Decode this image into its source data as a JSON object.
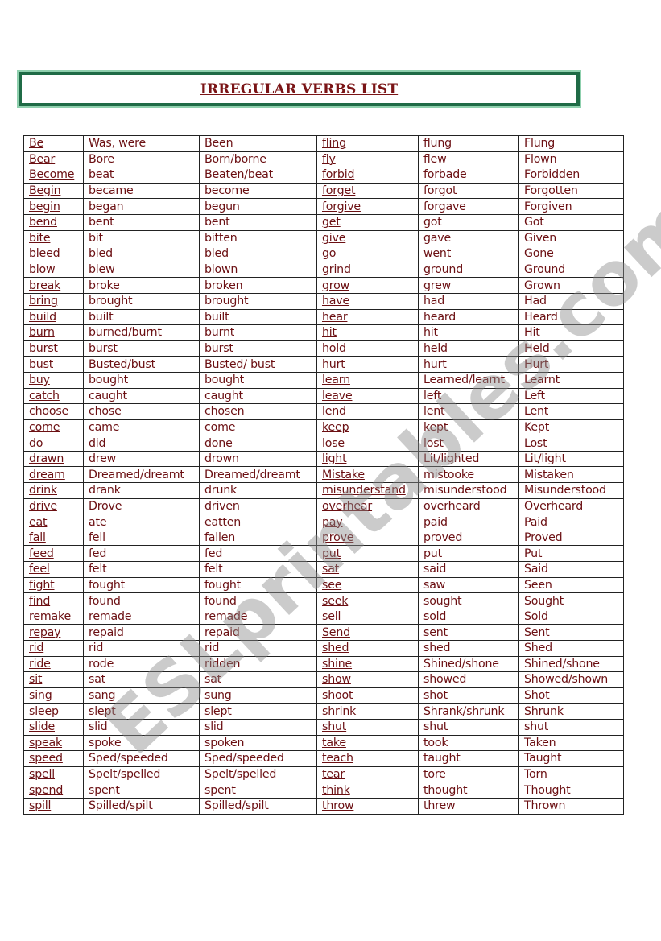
{
  "title": "IRREGULAR VERBS LIST",
  "watermark": "ESLprintables.com",
  "colors": {
    "text": "#6b0f12",
    "title": "#7a1416",
    "frame": "#1f6b46"
  },
  "rows": [
    {
      "l": [
        "Be",
        "Was, were",
        "Been"
      ],
      "r": [
        "fling",
        "flung",
        "Flung"
      ]
    },
    {
      "l": [
        "Bear",
        "Bore",
        "Born/borne"
      ],
      "r": [
        "fly",
        "flew",
        "Flown"
      ]
    },
    {
      "l": [
        "Become",
        "beat",
        "Beaten/beat"
      ],
      "r": [
        "forbid",
        "forbade",
        "Forbidden"
      ]
    },
    {
      "l": [
        "Begin",
        "became",
        "become"
      ],
      "r": [
        "forget",
        "forgot",
        "Forgotten"
      ]
    },
    {
      "l": [
        "begin",
        "began",
        "begun"
      ],
      "r": [
        "forgive",
        "forgave",
        "Forgiven"
      ]
    },
    {
      "l": [
        "bend",
        "bent",
        "bent"
      ],
      "r": [
        "get",
        "got",
        "Got"
      ]
    },
    {
      "l": [
        "bite",
        "bit",
        "bitten"
      ],
      "r": [
        "give",
        "gave",
        "Given"
      ]
    },
    {
      "l": [
        "bleed",
        "bled",
        "bled"
      ],
      "r": [
        "go",
        "went",
        "Gone"
      ]
    },
    {
      "l": [
        "blow",
        "blew",
        "blown"
      ],
      "r": [
        "grind",
        "ground",
        "Ground"
      ]
    },
    {
      "l": [
        "break",
        "broke",
        "broken"
      ],
      "r": [
        "grow",
        "grew",
        "Grown"
      ]
    },
    {
      "l": [
        "bring",
        "brought",
        "brought"
      ],
      "r": [
        "have",
        "had",
        "Had"
      ]
    },
    {
      "l": [
        "build",
        "built",
        "built"
      ],
      "r": [
        "hear",
        "heard",
        "Heard"
      ]
    },
    {
      "l": [
        "burn",
        "burned/burnt",
        "burnt"
      ],
      "r": [
        "hit",
        "hit",
        "Hit"
      ]
    },
    {
      "l": [
        "burst",
        "burst",
        "burst"
      ],
      "r": [
        "hold",
        "held",
        "Held"
      ]
    },
    {
      "l": [
        "bust",
        "Busted/bust",
        "Busted/ bust"
      ],
      "r": [
        "hurt",
        "hurt",
        "Hurt"
      ]
    },
    {
      "l": [
        "buy",
        "bought",
        "bought"
      ],
      "r": [
        "learn",
        "Learned/learnt",
        "Learnt"
      ]
    },
    {
      "l": [
        "catch",
        "caught",
        "caught"
      ],
      "r": [
        "leave",
        "left",
        "Left"
      ]
    },
    {
      "l": [
        "choose",
        "chose",
        "chosen"
      ],
      "r": [
        "lend",
        "lent",
        "Lent"
      ]
    },
    {
      "l": [
        "come",
        "came",
        "come"
      ],
      "r": [
        "keep",
        "kept",
        "Kept"
      ]
    },
    {
      "l": [
        "do",
        "did",
        "done"
      ],
      "r": [
        "lose",
        "lost",
        "Lost"
      ]
    },
    {
      "l": [
        "drawn",
        "drew",
        "drown"
      ],
      "r": [
        "light",
        "Lit/lighted",
        "Lit/light"
      ]
    },
    {
      "l": [
        "dream",
        "Dreamed/dreamt",
        "Dreamed/dreamt"
      ],
      "r": [
        "Mistake",
        "mistooke",
        "Mistaken"
      ]
    },
    {
      "l": [
        "drink",
        "drank",
        "drunk"
      ],
      "r": [
        "misunderstand",
        "misunderstood",
        "Misunderstood"
      ]
    },
    {
      "l": [
        "drive",
        "Drove",
        "driven"
      ],
      "r": [
        "overhear",
        "overheard",
        "Overheard"
      ]
    },
    {
      "l": [
        "eat",
        "ate",
        "eatten"
      ],
      "r": [
        "pay",
        "paid",
        "Paid"
      ]
    },
    {
      "l": [
        "fall",
        "fell",
        "fallen"
      ],
      "r": [
        "prove",
        "proved",
        "Proved"
      ]
    },
    {
      "l": [
        "feed",
        "fed",
        "fed"
      ],
      "r": [
        "put",
        "put",
        "Put"
      ]
    },
    {
      "l": [
        "feel",
        "felt",
        "felt"
      ],
      "r": [
        "sat",
        "said",
        "Said"
      ]
    },
    {
      "l": [
        "fight",
        "fought",
        "fought"
      ],
      "r": [
        "see",
        "saw",
        "Seen"
      ]
    },
    {
      "l": [
        "find",
        "found",
        "found"
      ],
      "r": [
        "seek",
        "sought",
        "Sought"
      ]
    },
    {
      "l": [
        "remake",
        "remade",
        "remade"
      ],
      "r": [
        "sell",
        "sold",
        "Sold"
      ]
    },
    {
      "l": [
        "repay",
        "repaid",
        "repaid"
      ],
      "r": [
        "Send",
        "sent",
        "Sent"
      ]
    },
    {
      "l": [
        "rid",
        "rid",
        "rid"
      ],
      "r": [
        "shed",
        "shed",
        "Shed"
      ]
    },
    {
      "l": [
        "ride",
        "rode",
        "ridden"
      ],
      "r": [
        "shine",
        "Shined/shone",
        "Shined/shone"
      ]
    },
    {
      "l": [
        "sit",
        "sat",
        "sat"
      ],
      "r": [
        "show",
        "showed",
        "Showed/shown"
      ]
    },
    {
      "l": [
        "sing",
        "sang",
        "sung"
      ],
      "r": [
        "shoot",
        "shot",
        "Shot"
      ]
    },
    {
      "l": [
        "sleep",
        "slept",
        "slept"
      ],
      "r": [
        "shrink",
        "Shrank/shrunk",
        "Shrunk"
      ]
    },
    {
      "l": [
        "slide",
        "slid",
        "slid"
      ],
      "r": [
        "shut",
        "shut",
        "shut"
      ]
    },
    {
      "l": [
        "speak",
        "spoke",
        "spoken"
      ],
      "r": [
        "take",
        "took",
        "Taken"
      ]
    },
    {
      "l": [
        "speed",
        "Sped/speeded",
        "Sped/speeded"
      ],
      "r": [
        "teach",
        "taught",
        "Taught"
      ]
    },
    {
      "l": [
        "spell",
        "Spelt/spelled",
        "Spelt/spelled"
      ],
      "r": [
        "tear",
        "tore",
        "Torn"
      ]
    },
    {
      "l": [
        "spend",
        "spent",
        "spent"
      ],
      "r": [
        "think",
        "thought",
        "Thought"
      ]
    },
    {
      "l": [
        "spill",
        "Spilled/spilt",
        "Spilled/spilt"
      ],
      "r": [
        "throw",
        "threw",
        "Thrown"
      ]
    }
  ]
}
